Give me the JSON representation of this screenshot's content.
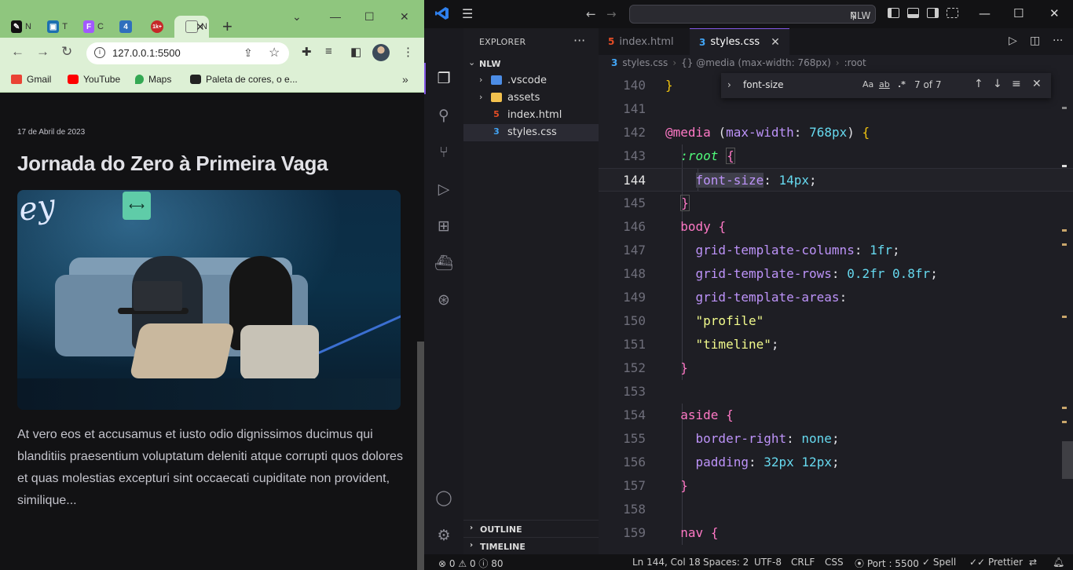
{
  "browser": {
    "tabs": [
      {
        "favicon": "notion-icon",
        "title": "N"
      },
      {
        "favicon": "cube-icon",
        "title": "T"
      },
      {
        "favicon": "figma-icon",
        "title": "C"
      },
      {
        "favicon": "four-icon",
        "title": "4"
      },
      {
        "favicon": "badge-icon",
        "title": "1k+"
      },
      {
        "favicon": "page-icon",
        "title": "N"
      }
    ],
    "url": "127.0.0.1:5500",
    "bookmarks": [
      {
        "icon": "gmail-icon",
        "label": "Gmail",
        "color": "#ea4335"
      },
      {
        "icon": "youtube-icon",
        "label": "YouTube",
        "color": "#ff0000"
      },
      {
        "icon": "maps-icon",
        "label": "Maps",
        "color": "#34a853"
      },
      {
        "icon": "palette-icon",
        "label": "Paleta de cores, o e..."
      }
    ],
    "page": {
      "date": "17 de Abril de 2023",
      "title": "Jornada do Zero à Primeira Vaga",
      "body": "At vero eos et accusamus et iusto odio dignissimos ducimus qui blanditiis praesentium voluptatum deleniti atque corrupti quos dolores et quas molestias excepturi sint occaecati cupiditate non provident, similique..."
    },
    "theme_color": "#8fc67e"
  },
  "vscode": {
    "search_label": "NLW",
    "explorer": {
      "header": "EXPLORER",
      "root": "NLW",
      "items": [
        {
          "name": ".vscode",
          "kind": "folder"
        },
        {
          "name": "assets",
          "kind": "folder"
        },
        {
          "name": "index.html",
          "kind": "html"
        },
        {
          "name": "styles.css",
          "kind": "css"
        }
      ],
      "sections": [
        "OUTLINE",
        "TIMELINE"
      ]
    },
    "tabs": [
      {
        "label": "index.html",
        "kind": "html",
        "active": false
      },
      {
        "label": "styles.css",
        "kind": "css",
        "active": true
      }
    ],
    "breadcrumb": [
      "styles.css",
      "{} @media (max-width: 768px)",
      ":root"
    ],
    "find": {
      "query": "font-size",
      "case_label": "Aa",
      "word_label": "ab",
      "regex_label": ".*",
      "count": "7 of 7"
    },
    "line_numbers": [
      "140",
      "141",
      "142",
      "143",
      "144",
      "145",
      "146",
      "147",
      "148",
      "149",
      "150",
      "151",
      "152",
      "153",
      "154",
      "155",
      "156",
      "157",
      "158",
      "159"
    ],
    "current_line": "144",
    "status": {
      "errors": "0",
      "warnings": "0",
      "info": "80",
      "position": "Ln 144, Col 18",
      "spaces": "Spaces: 2",
      "encoding": "UTF-8",
      "eol": "CRLF",
      "language": "CSS",
      "port": "Port : 5500",
      "spell": "Spell",
      "prettier": "Prettier"
    },
    "accent": "#8257e5"
  }
}
